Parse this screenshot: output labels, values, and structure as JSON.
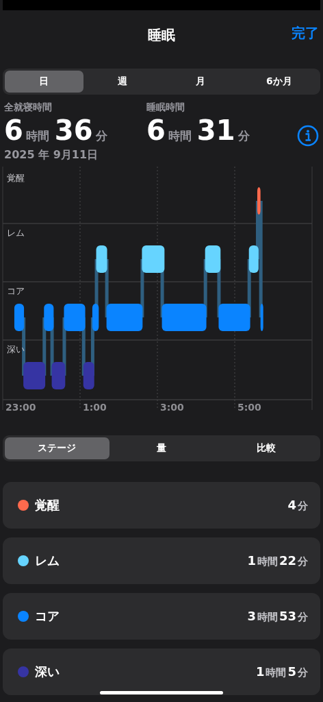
{
  "nav": {
    "title": "睡眠",
    "done": "完了"
  },
  "period_tabs": [
    {
      "label": "日",
      "selected": true
    },
    {
      "label": "週",
      "selected": false
    },
    {
      "label": "月",
      "selected": false
    },
    {
      "label": "6か月",
      "selected": false
    }
  ],
  "stats": [
    {
      "label": "全就寝時間",
      "parts": [
        {
          "num": "6",
          "unit": "時間"
        },
        {
          "num": "36",
          "unit": "分"
        }
      ]
    },
    {
      "label": "睡眠時間",
      "parts": [
        {
          "num": "6",
          "unit": "時間"
        },
        {
          "num": "31",
          "unit": "分"
        }
      ]
    }
  ],
  "date": "2025 年 9月11日",
  "hypnogram": {
    "stage_labels": [
      "覚醒",
      "レム",
      "コア",
      "深い"
    ],
    "time_labels": [
      "23:00",
      "1:00",
      "3:00",
      "5:00"
    ]
  },
  "view_tabs": [
    {
      "label": "ステージ",
      "selected": true
    },
    {
      "label": "量",
      "selected": false
    },
    {
      "label": "比較",
      "selected": false
    }
  ],
  "stages": [
    {
      "name": "覚醒",
      "color": "#ff6a4d",
      "parts": [
        {
          "num": "4",
          "unit": "分"
        }
      ]
    },
    {
      "name": "レム",
      "color": "#66d4ff",
      "parts": [
        {
          "num": "1",
          "unit": "時間"
        },
        {
          "num": "22",
          "unit": "分"
        }
      ]
    },
    {
      "name": "コア",
      "color": "#0a84ff",
      "parts": [
        {
          "num": "3",
          "unit": "時間"
        },
        {
          "num": "53",
          "unit": "分"
        }
      ]
    },
    {
      "name": "深い",
      "color": "#3634a3",
      "parts": [
        {
          "num": "1",
          "unit": "時間"
        },
        {
          "num": "5",
          "unit": "分"
        }
      ]
    }
  ]
}
